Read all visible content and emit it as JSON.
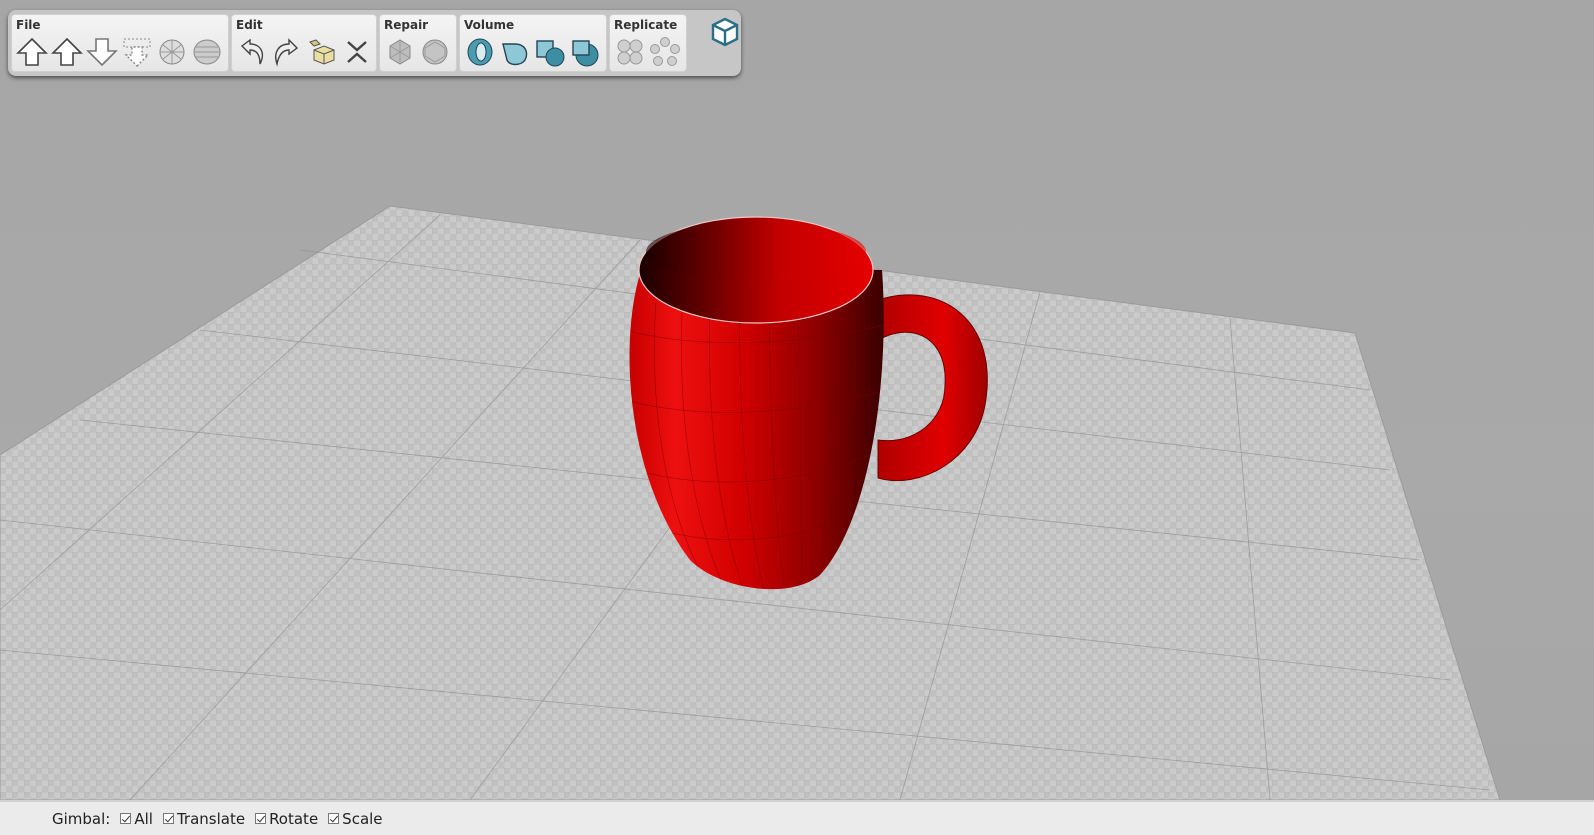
{
  "toolbar": {
    "groups": [
      {
        "label": "File",
        "tools": [
          "load-up-icon",
          "move-up-icon",
          "move-down-icon",
          "drop-to-floor-icon",
          "wireframe-sphere-icon",
          "slice-sphere-icon"
        ]
      },
      {
        "label": "Edit",
        "tools": [
          "undo-icon",
          "redo-icon",
          "copy-object-icon",
          "delete-icon"
        ]
      },
      {
        "label": "Repair",
        "tools": [
          "repair-mesh-icon",
          "repair-sphere-icon"
        ]
      },
      {
        "label": "Volume",
        "tools": [
          "torus-icon",
          "cylinder-icon",
          "box-union-icon",
          "box-subtract-icon"
        ]
      },
      {
        "label": "Replicate",
        "tools": [
          "grid-replicate-icon",
          "circle-replicate-icon"
        ]
      }
    ],
    "view_cube_icon": "view-cube-icon"
  },
  "viewport": {
    "object": "red mug",
    "object_color": "#d40000",
    "floor_color": "#c9c9c9",
    "background_color": "#a8a8a8"
  },
  "gimbal": {
    "label": "Gimbal:",
    "options": [
      {
        "label": "All",
        "checked": true
      },
      {
        "label": "Translate",
        "checked": true
      },
      {
        "label": "Rotate",
        "checked": true
      },
      {
        "label": "Scale",
        "checked": true
      }
    ]
  }
}
